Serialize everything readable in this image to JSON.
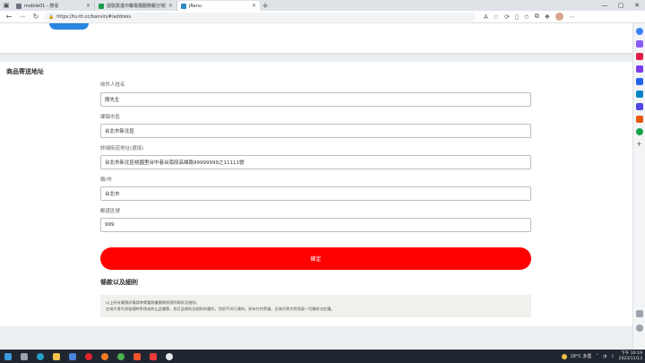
{
  "browser": {
    "tabs": [
      {
        "title": "mobile01 - 搜尋",
        "favicon_color": "#6b7280"
      },
      {
        "title": "從取貨進中藥電價服務報分地別",
        "favicon_color": "#1a9d4b"
      },
      {
        "title": "jRenu",
        "favicon_color": "#2b8cc4"
      }
    ],
    "address": "https://tu-th.cc/banvin/#/address",
    "colors": {
      "tab_bar": "#dfe3e8",
      "toolbar": "#ffffff"
    }
  },
  "form": {
    "section_title": "商品寄送地址",
    "fields": [
      {
        "label": "收件人姓名",
        "value": "簡先生"
      },
      {
        "label": "鄉鎮市區",
        "value": "台北市新北區"
      },
      {
        "label": "詳細街道地址(選填)",
        "value": "台北市新北區桃園里台中巷台南段高雄路99999999之11111號"
      },
      {
        "label": "縣/市",
        "value": "台北市"
      },
      {
        "label": "郵遞區號",
        "value": "999"
      }
    ],
    "submit_label": "確定",
    "submit_color": "#ff0000"
  },
  "terms": {
    "title": "條款以及細則",
    "lines": [
      "以上所有優惠詳情請參閱寬頻優惠網頁說明條款及細則。",
      "台灣大哥大保留隨時更改或終止此優惠，修訂此條款及細則的權利，而恕不另行通知。如有任何爭議，台灣大哥大將保留一切最終決定權。"
    ]
  },
  "taskbar": {
    "weather": "18°C 多雲",
    "time": "下午 10:19",
    "date": "2023/11/13"
  }
}
